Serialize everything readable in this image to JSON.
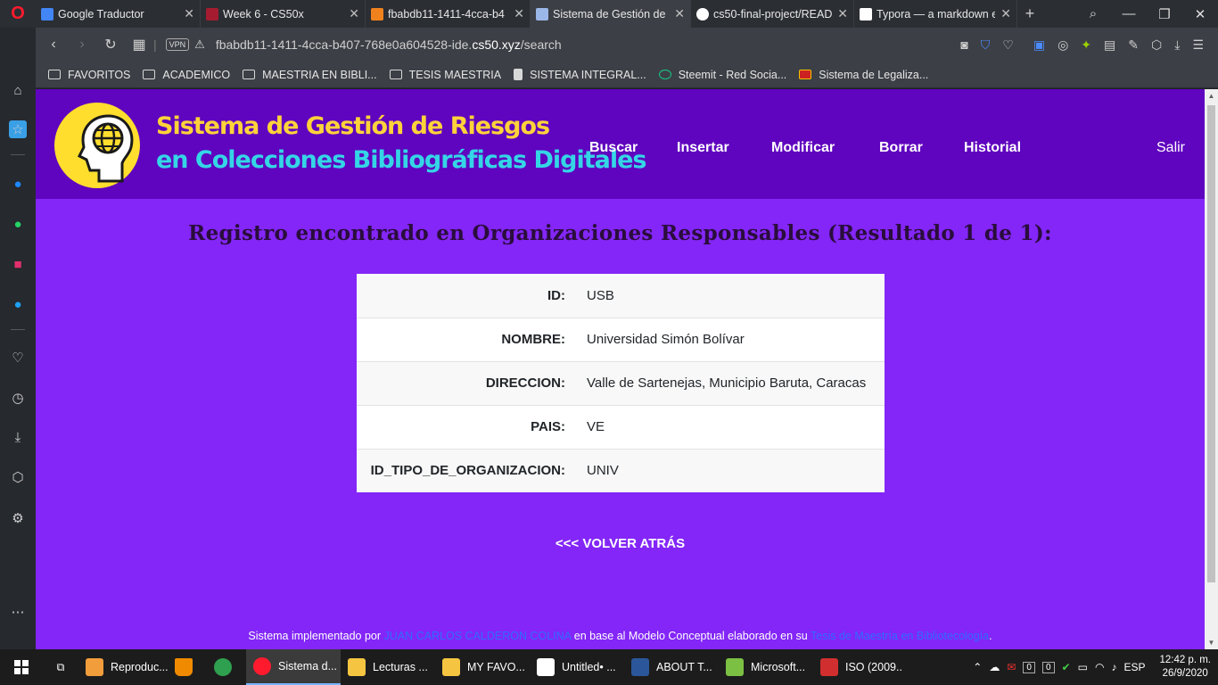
{
  "browser": {
    "tabs": [
      {
        "label": "Google Traductor",
        "color": "#4285f4"
      },
      {
        "label": "Week 6 - CS50x",
        "color": "#a51c30"
      },
      {
        "label": "fbabdb11-1411-4cca-b4",
        "color": "#f0821e"
      },
      {
        "label": "Sistema de Gestión de R",
        "color": "#9bb7e8"
      },
      {
        "label": "cs50-final-project/READ",
        "color": "#ffffff"
      },
      {
        "label": "Typora — a markdown e",
        "color": "#ffffff"
      }
    ],
    "url_prefix": "fbabdb11-1411-4cca-b407-768e0a604528-ide.",
    "url_domain": "cs50.xyz",
    "url_path": "/search",
    "vpn_label": "VPN",
    "bookmarks": [
      "FAVORITOS",
      "ACADEMICO",
      "MAESTRIA EN BIBLI...",
      "TESIS MAESTRIA",
      "SISTEMA INTEGRAL...",
      "Steemit - Red Socia...",
      "Sistema de Legaliza..."
    ]
  },
  "site": {
    "title_line1": "Sistema de Gestión de Riesgos",
    "title_line2": "en Colecciones Bibliográficas Digitales",
    "nav": {
      "buscar": "Buscar",
      "insertar": "Insertar",
      "modificar": "Modificar",
      "borrar": "Borrar",
      "historial": "Historial",
      "salir": "Salir"
    }
  },
  "result": {
    "heading": "Registro encontrado en Organizaciones Responsables (Resultado 1 de 1):",
    "rows": [
      {
        "key": "ID:",
        "value": "USB"
      },
      {
        "key": "NOMBRE:",
        "value": "Universidad Simón Bolívar"
      },
      {
        "key": "DIRECCION:",
        "value": "Valle de Sartenejas, Municipio Baruta, Caracas"
      },
      {
        "key": "PAIS:",
        "value": "VE"
      },
      {
        "key": "ID_TIPO_DE_ORGANIZACION:",
        "value": "UNIV"
      }
    ],
    "back_link": "<<< VOLVER ATRÁS"
  },
  "footer": {
    "text1": "Sistema implementado por ",
    "author": "JUAN CARLOS CALDERON COLINA",
    "text2": " en base al Modelo Conceptual elaborado en su ",
    "thesis": "Tesis de Maestría en Bibliotecología",
    "text3": "."
  },
  "taskbar": {
    "items": [
      {
        "label": "Reproduc...",
        "color": "#f29d3c"
      },
      {
        "label": "",
        "color": "#f08a00"
      },
      {
        "label": "",
        "color": "#2fa04f"
      },
      {
        "label": "Sistema d...",
        "color": "#ff1b2d"
      },
      {
        "label": "Lecturas ...",
        "color": "#f5c542"
      },
      {
        "label": "MY FAVO...",
        "color": "#f5c542"
      },
      {
        "label": "Untitled• ...",
        "color": "#ffffff"
      },
      {
        "label": "ABOUT T...",
        "color": "#2b579a"
      },
      {
        "label": "Microsoft...",
        "color": "#7bc043"
      },
      {
        "label": "ISO (2009...",
        "color": "#d12f2f"
      }
    ],
    "tray_badges": [
      "0",
      "0"
    ],
    "language": "ESP",
    "time": "12:42 p. m.",
    "date": "26/9/2020"
  }
}
